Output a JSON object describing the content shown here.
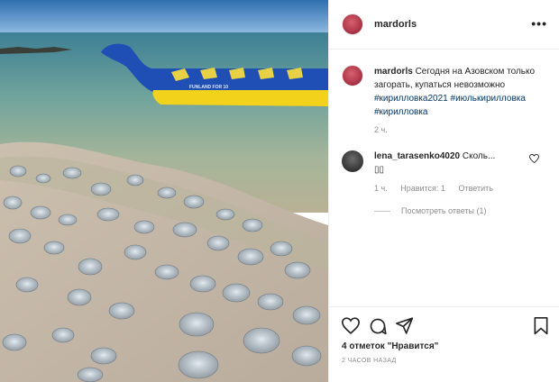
{
  "post": {
    "author": "mardorls",
    "more_icon": "more-horizontal-icon",
    "boat_print": "FUNLAND FOR 10",
    "caption": {
      "author": "mardorls",
      "text": "Сегодня на Азовском только загорать, купаться невозможно",
      "hashtags": [
        "#кирилловка2021",
        "#июлькирилловка",
        "#кирилловка"
      ],
      "time": "2 ч."
    },
    "comment": {
      "author": "lena_tarasenko4020",
      "text": "Сколь...",
      "emoji": "▯▯",
      "time": "1 ч.",
      "like_label": "Нравится: 1",
      "reply_label": "Ответить",
      "view_replies": "Посмотреть ответы (1)"
    },
    "likes_text": "4 отметок \"Нравится\"",
    "posted_ago": "2 ЧАСОВ НАЗАД",
    "colors": {
      "text": "#262626",
      "muted": "#8e8e8e",
      "hashtag": "#00376b",
      "border": "#efefef"
    }
  }
}
